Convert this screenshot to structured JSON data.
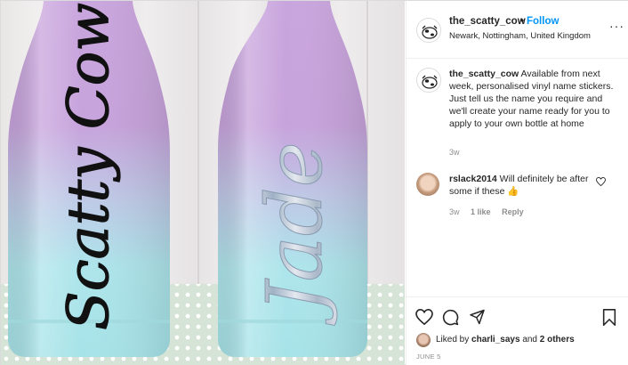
{
  "post": {
    "username": "the_scatty_cow",
    "separator": "•",
    "follow_label": "Follow",
    "location": "Newark, Nottingham, United Kingdom",
    "more_label": "···"
  },
  "photo": {
    "bottle_left_text": "Scatty Cow",
    "bottle_right_text": "Jade"
  },
  "caption": {
    "username": "the_scatty_cow",
    "text": "Available from next week, personalised vinyl name stickers. Just tell us the name you require and we'll create your name ready for you to apply to your own bottle at home",
    "time": "3w"
  },
  "comment": {
    "username": "rslack2014",
    "text": "Will definitely be after some if these",
    "emoji": "👍",
    "time": "3w",
    "likes": "1 like",
    "reply": "Reply"
  },
  "likes": {
    "prefix": "Liked by",
    "user": "charli_says",
    "joiner": "and",
    "others": "2 others"
  },
  "date": "JUNE 5",
  "colors": {
    "follow_blue": "#0095f6",
    "bottle_top": "#c9a3dc",
    "bottle_bottom": "#a8e6ea"
  }
}
